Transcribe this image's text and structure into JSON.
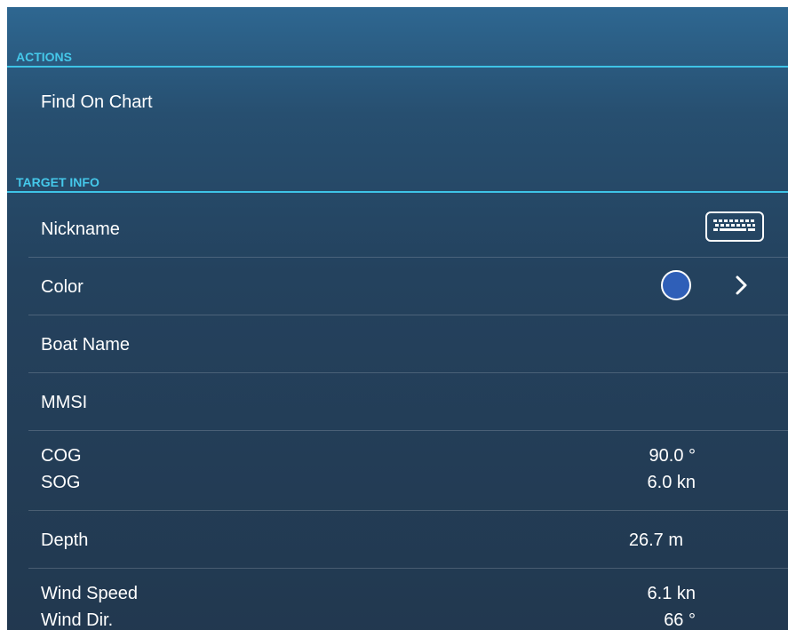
{
  "actions": {
    "header": "ACTIONS",
    "find_on_chart": "Find On Chart"
  },
  "target_info": {
    "header": "TARGET INFO",
    "nickname": {
      "label": "Nickname",
      "icon": "keyboard-icon"
    },
    "color": {
      "label": "Color",
      "swatch_color": "#2f5fb8",
      "icon": "chevron-right-icon"
    },
    "boat_name": {
      "label": "Boat Name"
    },
    "mmsi": {
      "label": "MMSI"
    },
    "cog": {
      "label": "COG",
      "value": "90.0 °"
    },
    "sog": {
      "label": "SOG",
      "value": "6.0 kn"
    },
    "depth": {
      "label": "Depth",
      "value": "26.7 m"
    },
    "wind_speed": {
      "label": "Wind Speed",
      "value": "6.1 kn"
    },
    "wind_dir": {
      "label": "Wind Dir.",
      "value": "66 °"
    }
  },
  "colors": {
    "accent": "#45c8ea",
    "panel_top": "#2e6791",
    "panel_bottom": "#22384f"
  }
}
